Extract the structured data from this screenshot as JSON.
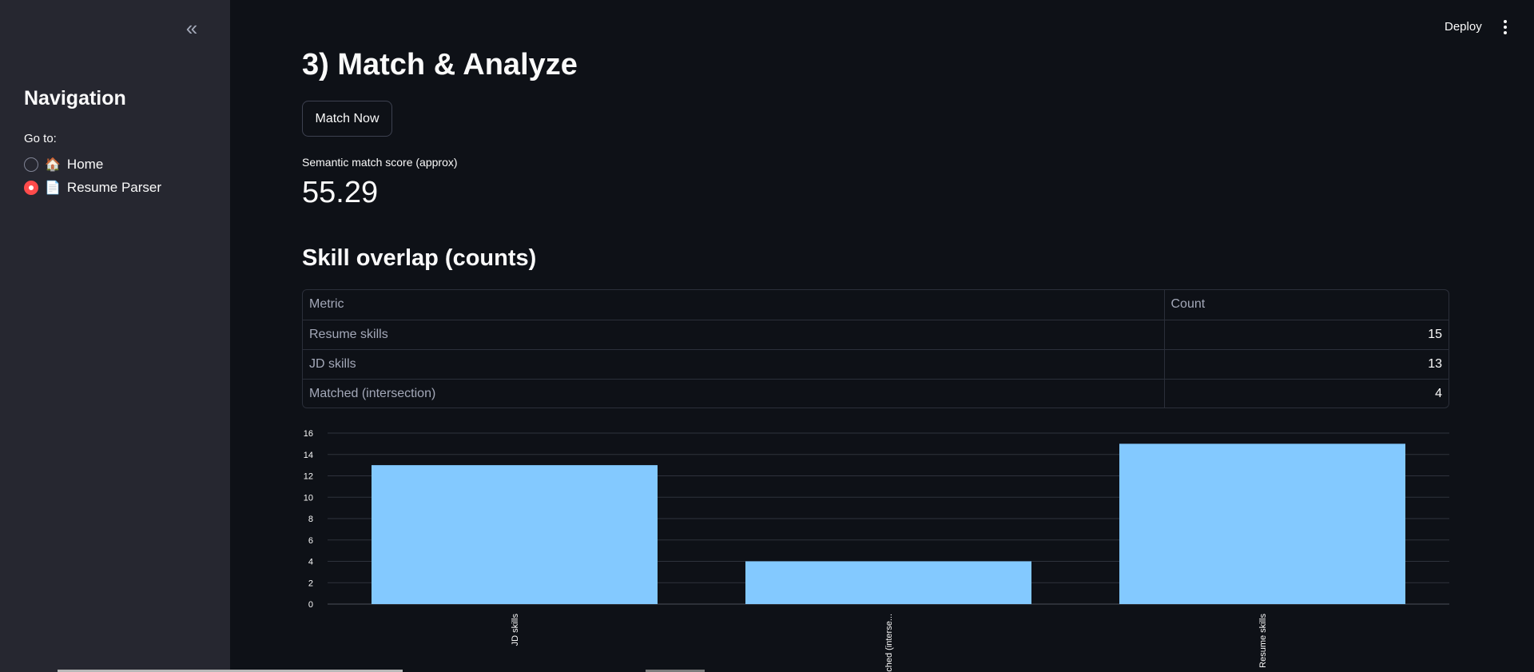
{
  "sidebar": {
    "collapse_icon": "chevrons-left-icon",
    "collapse_glyph": "«",
    "title": "Navigation",
    "goto_label": "Go to:",
    "options": [
      {
        "emoji": "🏠",
        "label": "Home",
        "selected": false
      },
      {
        "emoji": "📄",
        "label": "Resume Parser",
        "selected": true
      }
    ]
  },
  "topbar": {
    "deploy_label": "Deploy",
    "menu_icon": "kebab-menu-icon"
  },
  "main": {
    "title": "3) Match & Analyze",
    "match_button": "Match Now",
    "metric_label": "Semantic match score (approx)",
    "metric_value": "55.29",
    "section_title": "Skill overlap (counts)",
    "table": {
      "headers": [
        "Metric",
        "Count"
      ],
      "rows": [
        [
          "Resume skills",
          "15"
        ],
        [
          "JD skills",
          "13"
        ],
        [
          "Matched (intersection)",
          "4"
        ]
      ]
    }
  },
  "colors": {
    "accent": "#ff4b4b",
    "bar": "#83c9ff",
    "background": "#0e1117",
    "sidebar": "#262730"
  },
  "chart_data": {
    "type": "bar",
    "categories": [
      "JD skills",
      "Matched (intersection)",
      "Resume skills"
    ],
    "category_labels_visible": [
      "JD skills",
      "Matched (interse...",
      "Resume skills"
    ],
    "values": [
      13,
      4,
      15
    ],
    "title": "",
    "xlabel": "",
    "ylabel": "",
    "ylim": [
      0,
      16
    ],
    "yticks": [
      0,
      2,
      4,
      6,
      8,
      10,
      12,
      14,
      16
    ],
    "grid": true
  }
}
